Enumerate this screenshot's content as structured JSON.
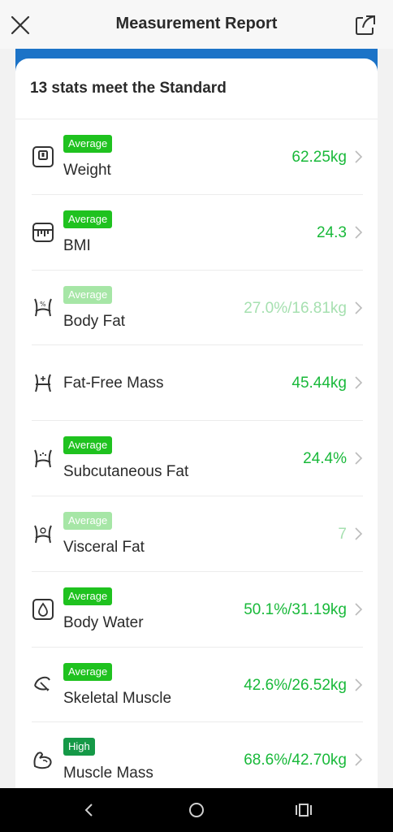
{
  "header": {
    "title": "Measurement Report",
    "close_icon": "close-icon",
    "share_icon": "share-icon"
  },
  "summary": "13 stats meet the Standard",
  "accent_color": "#19b93a",
  "metrics": [
    {
      "badge": "Average",
      "name": "Weight",
      "value": "62.25kg",
      "icon": "weight-scale-icon"
    },
    {
      "badge": "Average",
      "name": "BMI",
      "value": "24.3",
      "icon": "bmi-icon"
    },
    {
      "badge": "Average",
      "name": "Body Fat",
      "value": "27.0%/16.81kg",
      "icon": "body-fat-icon"
    },
    {
      "badge": "",
      "name": "Fat-Free Mass",
      "value": "45.44kg",
      "icon": "fat-free-mass-icon"
    },
    {
      "badge": "Average",
      "name": "Subcutaneous Fat",
      "value": "24.4%",
      "icon": "subcutaneous-fat-icon"
    },
    {
      "badge": "Average",
      "name": "Visceral Fat",
      "value": "7",
      "icon": "visceral-fat-icon"
    },
    {
      "badge": "Average",
      "name": "Body Water",
      "value": "50.1%/31.19kg",
      "icon": "water-drop-icon"
    },
    {
      "badge": "Average",
      "name": "Skeletal Muscle",
      "value": "42.6%/26.52kg",
      "icon": "skeletal-muscle-icon"
    },
    {
      "badge": "High",
      "name": "Muscle Mass",
      "value": "68.6%/42.70kg",
      "icon": "muscle-arm-icon"
    }
  ],
  "system_nav": {
    "back_icon": "back-icon",
    "home_icon": "home-icon",
    "recents_icon": "recents-icon"
  }
}
